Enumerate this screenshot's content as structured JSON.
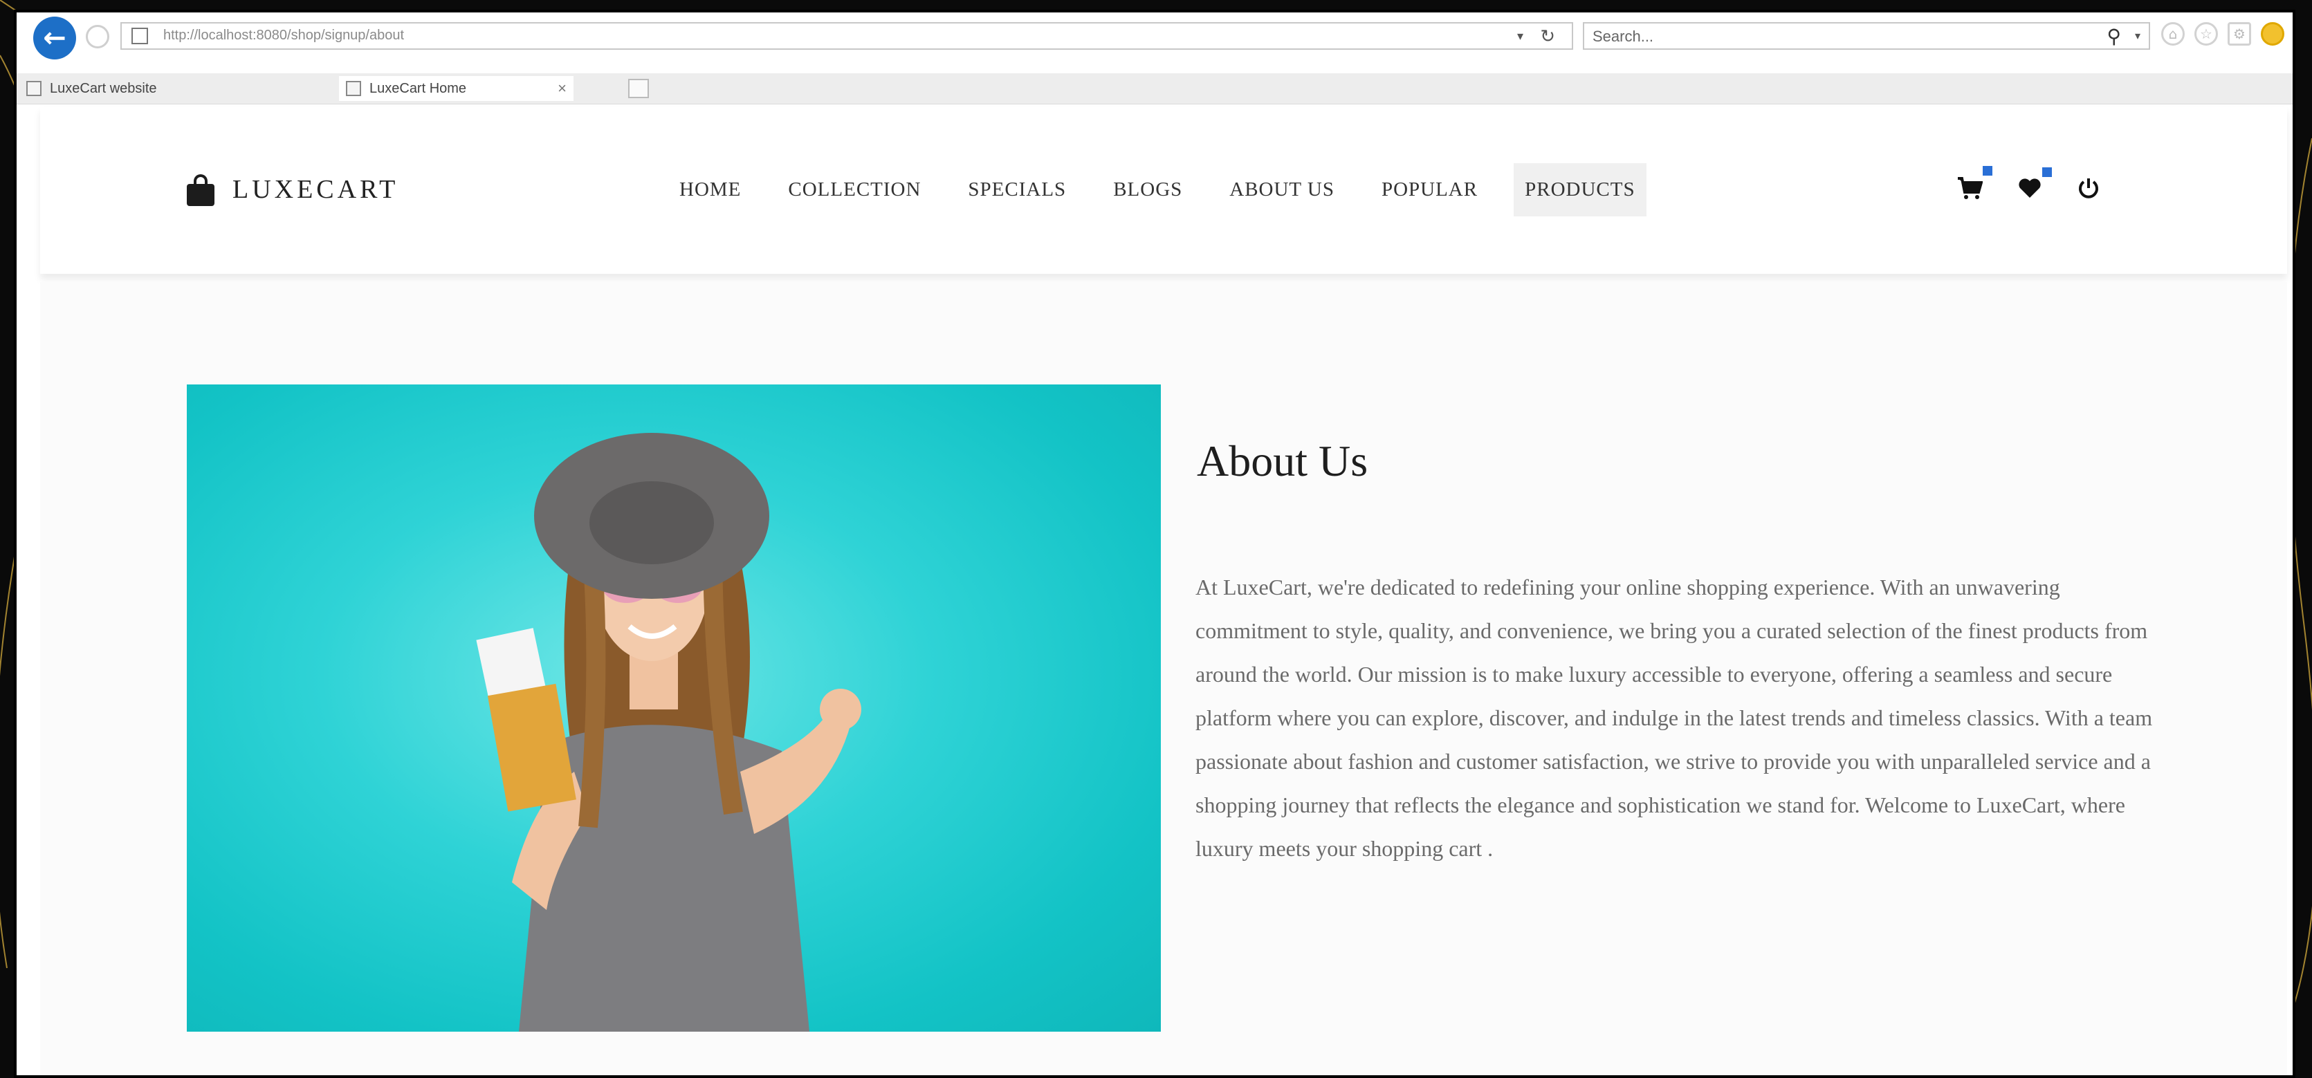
{
  "browser": {
    "url": "http://localhost:8080/shop/signup/about",
    "search_placeholder": "Search...",
    "tabs": [
      {
        "label": "LuxeCart website"
      },
      {
        "label": "LuxeCart Home",
        "close": "×"
      }
    ]
  },
  "header": {
    "logo": "LUXECART",
    "nav": [
      {
        "label": "HOME"
      },
      {
        "label": "COLLECTION"
      },
      {
        "label": "SPECIALS"
      },
      {
        "label": "BLOGS"
      },
      {
        "label": "ABOUT US"
      },
      {
        "label": "POPULAR"
      },
      {
        "label": "PRODUCTS",
        "active": true
      }
    ],
    "icons": [
      "cart-icon",
      "heart-icon",
      "power-icon"
    ]
  },
  "about": {
    "title": "About Us",
    "body": "At LuxeCart, we're dedicated to redefining your online shopping experience. With an unwavering commitment to style, quality, and convenience, we bring you a curated selection of the finest products from around the world. Our mission is to make luxury accessible to everyone, offering a seamless and secure platform where you can explore, discover, and indulge in the latest trends and timeless classics. With a team passionate about fashion and customer satisfaction, we strive to provide you with unparalleled service and a shopping journey that reflects the elegance and sophistication we stand for. Welcome to LuxeCart, where luxury meets your shopping cart ."
  },
  "colors": {
    "accent": "#2a6fd6",
    "hero_bg": "#1cc9cc",
    "frame": "#000000"
  }
}
